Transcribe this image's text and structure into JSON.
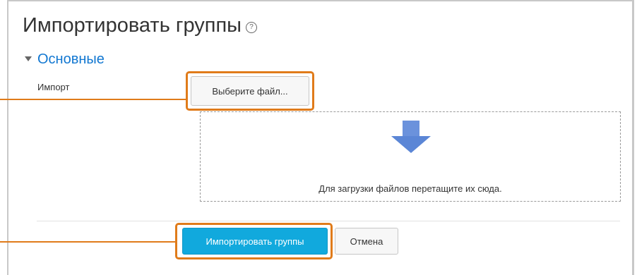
{
  "header": {
    "title": "Импортировать группы",
    "help_icon": "help-icon"
  },
  "section": {
    "title": "Основные",
    "icon": "caret-down-icon"
  },
  "import_field": {
    "label": "Импорт",
    "choose_file_label": "Выберите файл...",
    "dropzone_icon": "arrow-down-icon",
    "dropzone_text": "Для загрузки файлов перетащите их сюда."
  },
  "actions": {
    "submit_label": "Импортировать группы",
    "cancel_label": "Отмена"
  },
  "colors": {
    "accent": "#1177d1",
    "primary_button": "#11a9dd",
    "highlight": "#e07b1a",
    "arrow": "#5b86d6"
  }
}
